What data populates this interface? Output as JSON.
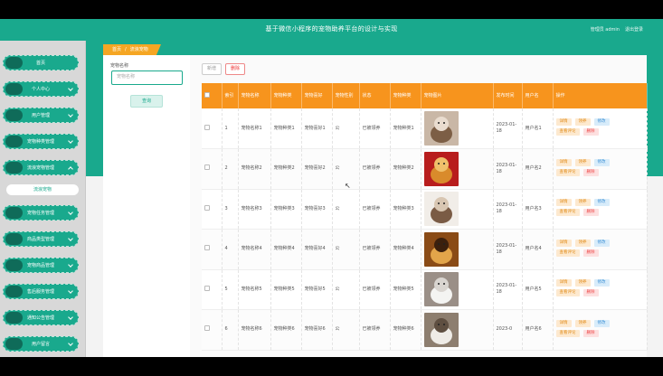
{
  "header": {
    "title": "基于微信小程序的宠物助养平台的设计与实现",
    "user_label": "管理员 admin",
    "logout_label": "退出登录"
  },
  "sidebar": {
    "items": [
      {
        "label": "首页"
      },
      {
        "label": "个人中心"
      },
      {
        "label": "用户管理"
      },
      {
        "label": "宠物种类管理"
      },
      {
        "label": "流浪宠物管理"
      },
      {
        "label": "宠物任务管理"
      },
      {
        "label": "商品类型管理"
      },
      {
        "label": "宠物商品管理"
      },
      {
        "label": "售后服务管理"
      },
      {
        "label": "通知公告管理"
      },
      {
        "label": "用户留言"
      }
    ],
    "active_submenu": "流浪宠物"
  },
  "breadcrumb": {
    "home": "首页",
    "current": "流浪宠物"
  },
  "search": {
    "label": "宠物名称",
    "placeholder": "宠物名称",
    "query_button": "查询"
  },
  "toolbar": {
    "add_label": "新增",
    "delete_label": "删除"
  },
  "table": {
    "headers": [
      "",
      "索引",
      "宠物名称",
      "宠物种类",
      "宠物喜好",
      "宠物性别",
      "状态",
      "宠物种类",
      "宠物图片",
      "发布时间",
      "用户名",
      "操作"
    ],
    "rows": [
      {
        "index": "1",
        "name": "宠物名称1",
        "kind": "宠物种类1",
        "hobby": "宠物喜好1",
        "gender": "公",
        "status": "已被领养",
        "kind2": "宠物种类1",
        "image": "cat-dog",
        "time": "2023-01-18",
        "user": "用户名1"
      },
      {
        "index": "2",
        "name": "宠物名称2",
        "kind": "宠物种类2",
        "hobby": "宠物喜好2",
        "gender": "公",
        "status": "已被领养",
        "kind2": "宠物种类2",
        "image": "golden-dog",
        "time": "2023-01-18",
        "user": "用户名2"
      },
      {
        "index": "3",
        "name": "宠物名称3",
        "kind": "宠物种类3",
        "hobby": "宠物喜好3",
        "gender": "公",
        "status": "已被领养",
        "kind2": "宠物种类3",
        "image": "siamese-cat",
        "time": "2023-01-18",
        "user": "用户名3"
      },
      {
        "index": "4",
        "name": "宠物名称4",
        "kind": "宠物种类4",
        "hobby": "宠物喜好4",
        "gender": "公",
        "status": "已被领养",
        "kind2": "宠物种类4",
        "image": "lion-dog",
        "time": "2023-01-18",
        "user": "用户名4"
      },
      {
        "index": "5",
        "name": "宠物名称5",
        "kind": "宠物种类5",
        "hobby": "宠物喜好5",
        "gender": "公",
        "status": "已被领养",
        "kind2": "宠物种类5",
        "image": "white-puppy",
        "time": "2023-01-18",
        "user": "用户名5"
      },
      {
        "index": "6",
        "name": "宠物名称6",
        "kind": "宠物种类6",
        "hobby": "宠物喜好6",
        "gender": "公",
        "status": "已被领养",
        "kind2": "宠物种类6",
        "image": "white-cat",
        "time": "2023-0",
        "user": "用户名6"
      }
    ],
    "actions": {
      "detail": "详情",
      "adopt": "领养",
      "edit": "修改",
      "review": "查看评论",
      "remove": "删除"
    }
  },
  "colors": {
    "teal": "#19a98d",
    "orange": "#f7941d"
  }
}
